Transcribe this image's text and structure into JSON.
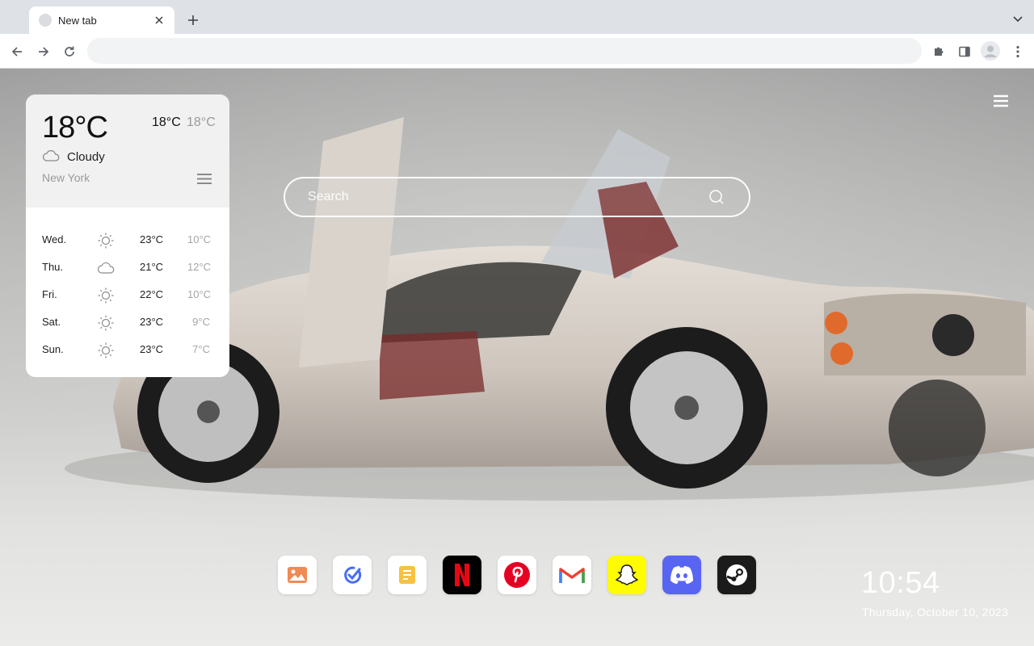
{
  "browser": {
    "tab": {
      "title": "New tab"
    },
    "omnibox": {
      "value": "",
      "placeholder": ""
    }
  },
  "weather": {
    "current_temp": "18°C",
    "high": "18°C",
    "low": "18°C",
    "condition": "Cloudy",
    "city": "New York",
    "forecast": [
      {
        "day": "Wed.",
        "icon": "sun-icon",
        "high": "23°C",
        "low": "10°C"
      },
      {
        "day": "Thu.",
        "icon": "cloud-icon",
        "high": "21°C",
        "low": "12°C"
      },
      {
        "day": "Fri.",
        "icon": "sun-icon",
        "high": "22°C",
        "low": "10°C"
      },
      {
        "day": "Sat.",
        "icon": "sun-icon",
        "high": "23°C",
        "low": "9°C"
      },
      {
        "day": "Sun.",
        "icon": "sun-icon",
        "high": "23°C",
        "low": "7°C"
      }
    ]
  },
  "search": {
    "placeholder": "Search"
  },
  "dock": {
    "apps": [
      {
        "name": "photos",
        "icon": "photo-icon",
        "color": "#ffffff"
      },
      {
        "name": "tasks",
        "icon": "check-icon",
        "color": "#ffffff"
      },
      {
        "name": "notes",
        "icon": "notes-icon",
        "color": "#ffffff"
      },
      {
        "name": "netflix",
        "icon": "netflix-icon",
        "color": "#000000"
      },
      {
        "name": "pinterest",
        "icon": "pinterest-icon",
        "color": "#ffffff"
      },
      {
        "name": "gmail",
        "icon": "gmail-icon",
        "color": "#ffffff"
      },
      {
        "name": "snapchat",
        "icon": "snapchat-icon",
        "color": "#fffc00"
      },
      {
        "name": "discord",
        "icon": "discord-icon",
        "color": "#5865f2"
      },
      {
        "name": "steam",
        "icon": "steam-icon",
        "color": "#1b1b1b"
      }
    ]
  },
  "clock": {
    "time": "10:54",
    "date": "Thursday, October 10, 2023"
  }
}
